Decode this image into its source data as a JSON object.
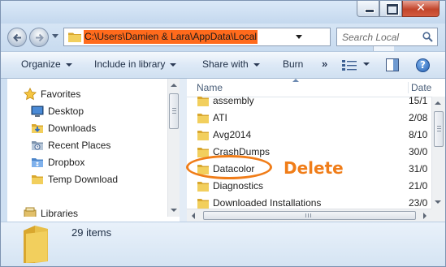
{
  "address_bar": {
    "path": "C:\\Users\\Damien & Lara\\AppData\\Local"
  },
  "search": {
    "placeholder": "Search Local"
  },
  "toolbar": {
    "organize_label": "Organize",
    "include_label": "Include in library",
    "share_label": "Share with",
    "burn_label": "Burn",
    "more_label": "»"
  },
  "nav_pane": {
    "favorites_label": "Favorites",
    "items": [
      {
        "label": "Desktop",
        "icon": "desktop-icon"
      },
      {
        "label": "Downloads",
        "icon": "downloads-folder-icon"
      },
      {
        "label": "Recent Places",
        "icon": "recent-places-icon"
      },
      {
        "label": "Dropbox",
        "icon": "dropbox-icon"
      },
      {
        "label": "Temp Download",
        "icon": "folder-icon"
      }
    ],
    "libraries_label": "Libraries"
  },
  "file_list": {
    "columns": {
      "name": "Name",
      "date": "Date"
    },
    "rows": [
      {
        "name": "assembly",
        "date": "15/1"
      },
      {
        "name": "ATI",
        "date": "2/08"
      },
      {
        "name": "Avg2014",
        "date": "8/10"
      },
      {
        "name": "CrashDumps",
        "date": "30/0"
      },
      {
        "name": "Datacolor",
        "date": "31/0"
      },
      {
        "name": "Diagnostics",
        "date": "21/0"
      },
      {
        "name": "Downloaded Installations",
        "date": "23/0"
      }
    ]
  },
  "annotation": {
    "label": "Delete",
    "color": "#f07d19"
  },
  "details": {
    "count_label": "29 items"
  },
  "colors": {
    "address_highlight": "#ff6a1c",
    "folder": "#e8c04a"
  }
}
